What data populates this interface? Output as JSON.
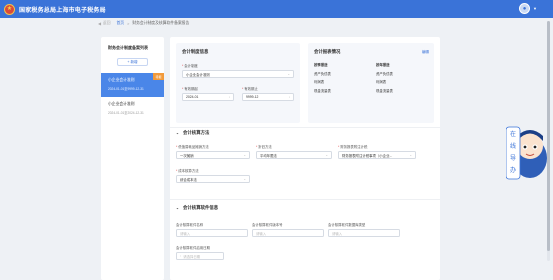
{
  "header": {
    "site_title": "国家税务总局上海市电子税务局",
    "logo_icon": "tax-emblem-icon",
    "user_icon": "user-avatar-icon",
    "brand_color": "#3a73d8"
  },
  "breadcrumb": {
    "back_label": "返回",
    "home": "首页",
    "separator": ">",
    "current": "财务会计制度及核算软件备案报告"
  },
  "sidebar": {
    "title": "财务会计制度备案列表",
    "add_label": "+ 新增",
    "items": [
      {
        "name": "小企业会计准则",
        "date": "2024-01-01至9999-12-31",
        "tag": "待报",
        "active": true
      },
      {
        "name": "小企业会计准则",
        "date": "2024-01-01至2024-12-31",
        "tag": "",
        "active": false
      }
    ]
  },
  "accounting_system": {
    "title": "会计制度信息",
    "system_label": "会计制度",
    "system_value": "小企业会计准则",
    "valid_from_label": "有效期起",
    "valid_from_value": "2024-01",
    "valid_to_label": "有效期止",
    "valid_to_value": "9999-12"
  },
  "reports": {
    "title": "会计报表情况",
    "link": "编辑",
    "col1_header": "按季报送",
    "col2_header": "按年报送",
    "col1": [
      "资产负债表",
      "利润表",
      "现金流量表"
    ],
    "col2": [
      "资产负债表",
      "利润表",
      "现金流量表"
    ]
  },
  "methods": {
    "title": "会计核算方法",
    "fields": [
      {
        "label": "低值易耗品摊销方法",
        "value": "一次摊销"
      },
      {
        "label": "折旧方法",
        "value": "平均年限法"
      },
      {
        "label": "财务报表附注计税",
        "value": "财务报表附注计税事项（小企业..."
      },
      {
        "label": "成本核算方法",
        "value": "综合成本法"
      }
    ]
  },
  "software": {
    "title": "会计核算软件信息",
    "fields": [
      {
        "label": "会计核算软件名称",
        "placeholder": "请输入"
      },
      {
        "label": "会计核算软件版本号",
        "placeholder": "请输入"
      },
      {
        "label": "会计核算软件数据库类型",
        "placeholder": "请输入"
      },
      {
        "label": "会计核算软件启用日期",
        "placeholder": "请选择日期"
      }
    ]
  },
  "mascot": {
    "label": "在线导办",
    "icon": "mascot-assistant-icon"
  }
}
